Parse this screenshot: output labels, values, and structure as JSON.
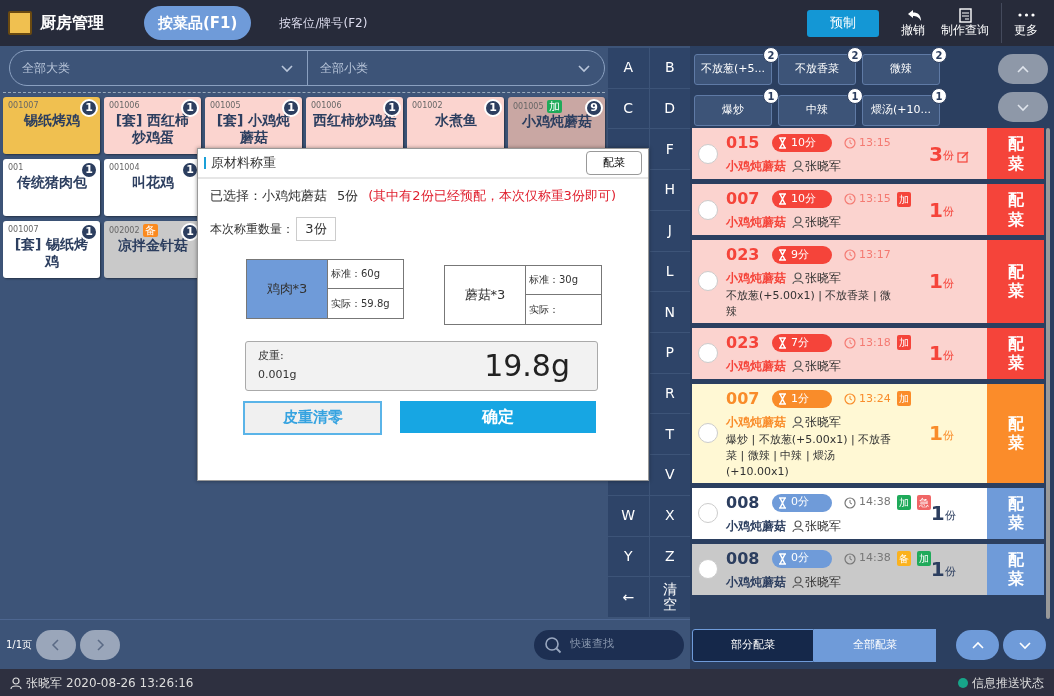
{
  "app": {
    "title": "厨房管理",
    "tabs": [
      {
        "label": "按菜品(F1)",
        "selected": true
      },
      {
        "label": "按客位/牌号(F2)",
        "selected": false
      }
    ],
    "actions": [
      {
        "kind": "primary",
        "label": "预制"
      },
      {
        "kind": "undo",
        "label": "撤销"
      },
      {
        "kind": "query",
        "label": "制作查询"
      },
      {
        "kind": "more",
        "label": "更多"
      }
    ]
  },
  "filters": [
    {
      "value": "全部大类"
    },
    {
      "value": "全部小类"
    }
  ],
  "dish_rows": [
    [
      {
        "code": "001007",
        "name": "锡纸烤鸡",
        "count": "1",
        "color": "#f0c050"
      },
      {
        "code": "001006",
        "name": "[套] 西红柿炒鸡蛋",
        "count": "1",
        "color": "#fbd4cf"
      },
      {
        "code": "001005",
        "name": "[套] 小鸡炖蘑菇",
        "count": "1",
        "color": "#fbd4cf"
      },
      {
        "code": "001006",
        "name": "西红柿炒鸡蛋",
        "count": "1",
        "color": "#fbd4cf"
      },
      {
        "code": "001002",
        "name": "水煮鱼",
        "count": "1",
        "color": "#fbd4cf"
      },
      {
        "code": "001005",
        "name": "小鸡炖蘑菇",
        "count": "9",
        "color": "#c9a7a3",
        "tag": {
          "label": "加",
          "color": "#1faa5a"
        }
      }
    ],
    [
      {
        "code": "001",
        "name": "传统猪肉包",
        "count": "1",
        "color": "#ffffff"
      },
      {
        "code": "001004",
        "name": "叫花鸡",
        "count": "1",
        "color": "#ffffff"
      }
    ],
    [
      {
        "code": "001007",
        "name": "[套] 锡纸烤鸡",
        "count": "1",
        "color": "#ffffff"
      },
      {
        "code": "002002",
        "name": "凉拌金针菇",
        "count": "1",
        "color": "#c9c9c9",
        "tag": {
          "label": "备",
          "color": "#fb8a1e"
        }
      }
    ]
  ],
  "keypad": [
    {
      "left": "A",
      "right": "B"
    },
    {
      "left": "C",
      "right": "D"
    },
    {
      "right": "F"
    },
    {
      "right": "H"
    },
    {
      "right": "J"
    },
    {
      "right": "L"
    },
    {
      "right": "N"
    },
    {
      "right": "P"
    },
    {
      "right": "R"
    },
    {
      "right": "T"
    },
    {
      "right": "V"
    },
    {
      "left": "W",
      "right": "X"
    },
    {
      "left": "Y",
      "right": "Z"
    },
    {
      "left": "←",
      "right": "清空"
    }
  ],
  "pager": {
    "page": "1/1页"
  },
  "search": {
    "placeholder": "快速查找"
  },
  "modal": {
    "title": "原材料称重",
    "corner_button": "配菜",
    "selected_label": "已选择：小鸡炖蘑菇",
    "selected_qty": "5份",
    "notice": "(其中有2份已经预配，本次仅称重3份即可)",
    "qty_label": "本次称重数量：",
    "qty_value": "3份",
    "ingredients": [
      {
        "name": "鸡肉*3",
        "standard": "标准：60g",
        "actual": "实际：59.8g",
        "selected": true
      },
      {
        "name": "蘑菇*3",
        "standard": "标准：30g",
        "actual": "实际：",
        "selected": false
      }
    ],
    "tare_label": "皮重:",
    "tare_value": "0.001g",
    "weight": "19.8g",
    "buttons": [
      {
        "kind": "secondary",
        "label": "皮重清零"
      },
      {
        "kind": "primary",
        "label": "确定"
      }
    ]
  },
  "tag_filters": [
    {
      "label": "不放葱(+5...",
      "count": "2"
    },
    {
      "label": "不放香菜",
      "count": "2"
    },
    {
      "label": "微辣",
      "count": "2"
    },
    {
      "label": "爆炒",
      "count": "1"
    },
    {
      "label": "中辣",
      "count": "1"
    },
    {
      "label": "煨汤(+10...",
      "count": "1"
    }
  ],
  "orders": [
    {
      "kind": "overdue",
      "selected": false,
      "number": "015",
      "timer": "10分",
      "time": "13:15",
      "dish": "小鸡炖蘑菇",
      "staff": "张晓军",
      "qty": "3",
      "unit": "份",
      "editable": true,
      "action": "配菜"
    },
    {
      "kind": "overdue",
      "selected": false,
      "number": "007",
      "timer": "10分",
      "time": "13:15",
      "tags": [
        {
          "label": "加",
          "color": "#f5443a"
        }
      ],
      "dish": "小鸡炖蘑菇",
      "staff": "张晓军",
      "qty": "1",
      "unit": "份",
      "editable": false,
      "action": "配菜"
    },
    {
      "kind": "overdue",
      "selected": false,
      "number": "023",
      "timer": "9分",
      "time": "13:17",
      "dish": "小鸡炖蘑菇",
      "staff": "张晓军",
      "note": "不放葱(+5.00x1) | 不放香菜 | 微辣",
      "qty": "1",
      "unit": "份",
      "editable": false,
      "action": "配菜"
    },
    {
      "kind": "overdue",
      "selected": false,
      "number": "023",
      "timer": "7分",
      "time": "13:18",
      "tags": [
        {
          "label": "加",
          "color": "#f5443a"
        }
      ],
      "dish": "小鸡炖蘑菇",
      "staff": "张晓军",
      "qty": "1",
      "unit": "份",
      "editable": false,
      "action": "配菜"
    },
    {
      "kind": "warning",
      "selected": false,
      "number": "007",
      "timer": "1分",
      "time": "13:24",
      "tags": [
        {
          "label": "加",
          "color": "#fb8c2a"
        }
      ],
      "dish": "小鸡炖蘑菇",
      "staff": "张晓军",
      "note": "爆炒 | 不放葱(+5.00x1) | 不放香菜 | 微辣 | 中辣 | 煨汤(+10.00x1)",
      "qty": "1",
      "unit": "份",
      "editable": false,
      "action": "配菜"
    },
    {
      "kind": "normal",
      "selected": false,
      "number": "008",
      "timer": "0分",
      "time": "14:38",
      "tags": [
        {
          "label": "加",
          "color": "#1faa5a"
        },
        {
          "label": "急",
          "color": "#f06666"
        }
      ],
      "dish": "小鸡炖蘑菇",
      "staff": "张晓军",
      "qty": "1",
      "unit": "份",
      "editable": false,
      "action": "配菜"
    },
    {
      "kind": "prepped",
      "selected": false,
      "number": "008",
      "timer": "0分",
      "time": "14:38",
      "tags": [
        {
          "label": "备",
          "color": "#fbb21e"
        },
        {
          "label": "加",
          "color": "#1faa5a"
        }
      ],
      "dish": "小鸡炖蘑菇",
      "staff": "张晓军",
      "qty": "1",
      "unit": "份",
      "editable": false,
      "action": "配菜"
    }
  ],
  "bottom_tabs": [
    {
      "label": "部分配菜",
      "selected": true
    },
    {
      "label": "全部配菜",
      "selected": false
    }
  ],
  "status_bar": {
    "user": "张晓军",
    "datetime": "2020-08-26 13:26:16",
    "push_status": "信息推送状态"
  }
}
